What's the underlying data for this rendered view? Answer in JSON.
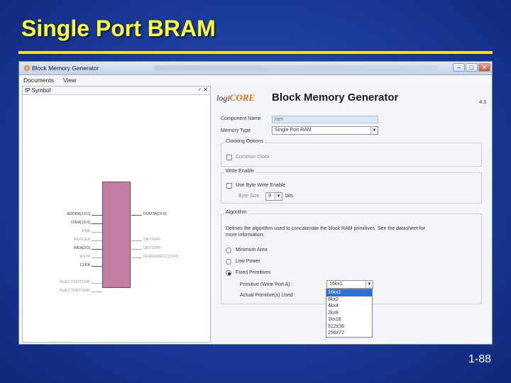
{
  "slide": {
    "title": "Single Port BRAM",
    "number": "1-88"
  },
  "window": {
    "title": "Block Memory Generator",
    "buttons": {
      "minimize": "–",
      "maximize": "□",
      "close": "✕"
    },
    "menu": [
      "Documents",
      "View"
    ]
  },
  "left_pane": {
    "title": "IP Symbol",
    "controls": "♂ ✕",
    "pins_left": [
      "ADDRA[13:0]",
      "DINA[15:0]",
      "ENA",
      "REGCEA",
      "WEA[0:0]",
      "RSTA",
      "CLKA",
      "INJECTSBITERR",
      "INJECTDBITERR"
    ],
    "pins_right": [
      "DOUTA[15:0]",
      "SBITERR",
      "DBITERR",
      "RDADDRECC[13:0]"
    ]
  },
  "right_pane": {
    "logo_prefix": "logi",
    "logo_suffix": "CORE",
    "heading": "Block Memory Generator",
    "version": "4.3",
    "component_name_label": "Component Name",
    "component_name_value": "ram",
    "memory_type_label": "Memory Type",
    "memory_type_value": "Single Port RAM",
    "clocking_group": "Clocking Options",
    "common_clock": "Common Clock",
    "write_enable_group": "Write Enable",
    "byte_write_enable": "Use Byte Write Enable",
    "byte_size_label": "Byte Size",
    "byte_size_value": "9",
    "byte_size_unit": "bits",
    "algorithm_group": "Algorithm",
    "algorithm_desc_1": "Defines the algorithm used to concatenate the block RAM primitives.  See the datasheet for",
    "algorithm_desc_2": "more information.",
    "options": [
      "Minimum Area",
      "Low Power",
      "Fixed Primitives"
    ],
    "primitive_label": "Primitive (Write Port A) :",
    "primitive_value": "16kx1",
    "actual_label": "Actual Primitive(s) Used :",
    "primitive_list": [
      "16kx1",
      "8kx2",
      "4kx4",
      "2kx9",
      "1kx18",
      "512x36",
      "256x72"
    ]
  }
}
